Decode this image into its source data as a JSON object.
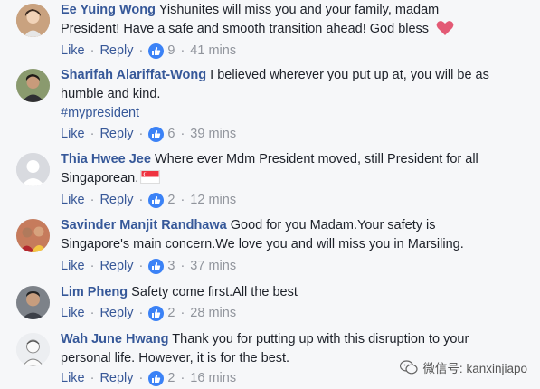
{
  "comments": [
    {
      "name": "Ee Yuing Wong",
      "text_line1": "Yishunites will miss you and your family, madam",
      "text_line2": "President! Have a safe and smooth transition ahead! God bless",
      "like_label": "Like",
      "reply_label": "Reply",
      "reactions": "9",
      "time": "41 mins",
      "avatar_color": "#b98e6a"
    },
    {
      "name": "Sharifah Alariffat-Wong",
      "text_line1": "I believed wherever you put up at, you will be as",
      "text_line2": "humble and kind.",
      "hashtag": "#mypresident",
      "like_label": "Like",
      "reply_label": "Reply",
      "reactions": "6",
      "time": "39 mins",
      "avatar_color": "#6b7c5a"
    },
    {
      "name": "Thia Hwee Jee",
      "text_line1": "Where ever Mdm President moved, still President for all",
      "text_line2": "Singaporean.",
      "like_label": "Like",
      "reply_label": "Reply",
      "reactions": "2",
      "time": "12 mins",
      "avatar_color": "#d8dadf"
    },
    {
      "name": "Savinder Manjit Randhawa",
      "text_line1": "Good for you Madam.Your safety is",
      "text_line2": "Singapore's main concern.We love you and will miss you in Marsiling.",
      "like_label": "Like",
      "reply_label": "Reply",
      "reactions": "3",
      "time": "37 mins",
      "avatar_color": "#a35a4a"
    },
    {
      "name": "Lim Pheng",
      "text_line1": "Safety come first.All the best",
      "like_label": "Like",
      "reply_label": "Reply",
      "reactions": "2",
      "time": "28 mins",
      "avatar_color": "#5a5f66"
    },
    {
      "name": "Wah June Hwang",
      "text_line1": "Thank you for putting up with this disruption to your",
      "text_line2": "personal life. However, it is for the best.",
      "like_label": "Like",
      "reply_label": "Reply",
      "reactions": "2",
      "time": "16 mins",
      "avatar_color": "#9aa0a8"
    }
  ],
  "watermark": {
    "text": "微信号: kanxinjiapo"
  },
  "colors": {
    "name": "#365899",
    "action": "#385898",
    "meta": "#90949c",
    "like": "#3b82f6"
  }
}
